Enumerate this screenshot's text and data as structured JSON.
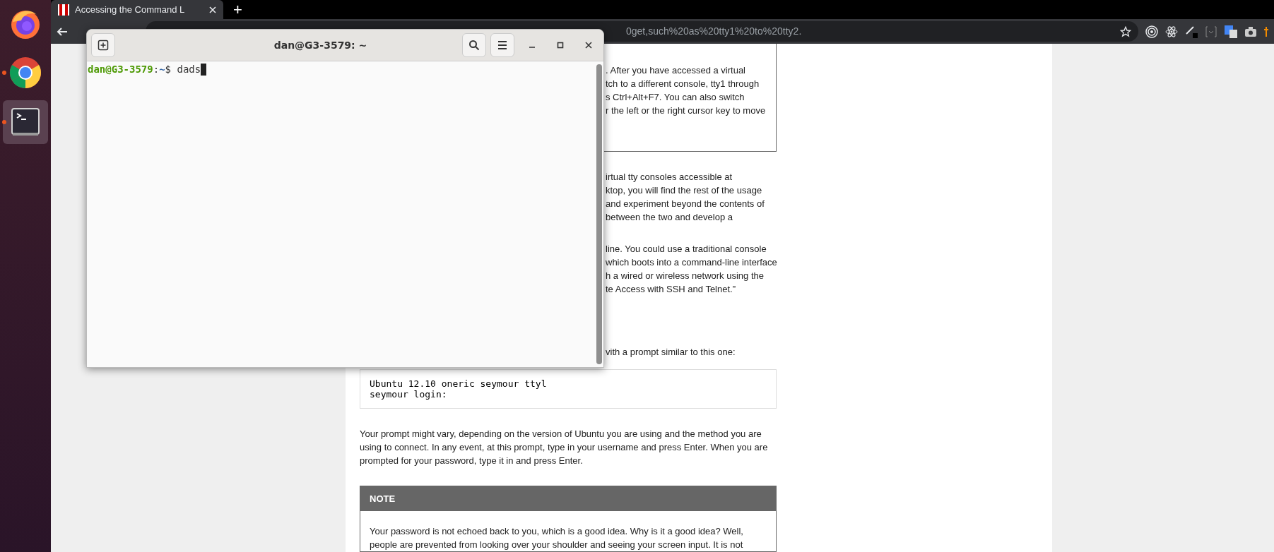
{
  "dock": {
    "apps": [
      {
        "kind": "firefox",
        "running": false,
        "selected": false
      },
      {
        "kind": "chrome",
        "running": true,
        "selected": false
      },
      {
        "kind": "terminal",
        "running": true,
        "selected": true
      }
    ]
  },
  "browser": {
    "tabs": [
      {
        "title": "Accessing the Command L",
        "selected": true
      }
    ],
    "new_tab": "+",
    "address": "0get,such%20as%20tty1%20to%20tty2."
  },
  "article": {
    "blocks": [
      {
        "kind": "boxed",
        "lines": [
          ". After you have accessed a virtual",
          "tch to a different console, tty1 through",
          "s Ctrl+Alt+F7. You can also switch",
          "r the left or the right cursor key to move"
        ]
      },
      {
        "kind": "fragments",
        "lines": [
          "irtual tty consoles accessible at",
          "ktop, you will find the rest of the usage",
          "and experiment beyond the contents of",
          "between the two and develop a"
        ]
      },
      {
        "kind": "fragments",
        "lines": [
          "line. You could use a traditional console",
          "which boots into a command-line interface",
          "h a wired or wireless network using the",
          "te Access with SSH and Telnet.”"
        ]
      },
      {
        "kind": "fragments",
        "lines": [
          "vith a prompt similar to this one:"
        ]
      },
      {
        "kind": "code",
        "lines": [
          "Ubuntu 12.10 oneric seymour ttyl",
          "seymour login:"
        ]
      },
      {
        "kind": "paragraph",
        "text": "Your prompt might vary, depending on the version of Ubuntu you are using and the method you are using to connect. In any event, at this prompt, type in your username and press Enter. When you are prompted for your password, type it in and press Enter."
      },
      {
        "kind": "note",
        "title": "NOTE",
        "text": "Your password is not echoed back to you, which is a good idea. Why is it a good idea? Well, people are prevented from looking over your shoulder and seeing your screen input. It is not"
      }
    ]
  },
  "terminal": {
    "title": "dan@G3-3579: ~",
    "user_host": "dan@G3-3579",
    "separator": ":",
    "path": "~",
    "prompt": "$ ",
    "input": "dads"
  }
}
